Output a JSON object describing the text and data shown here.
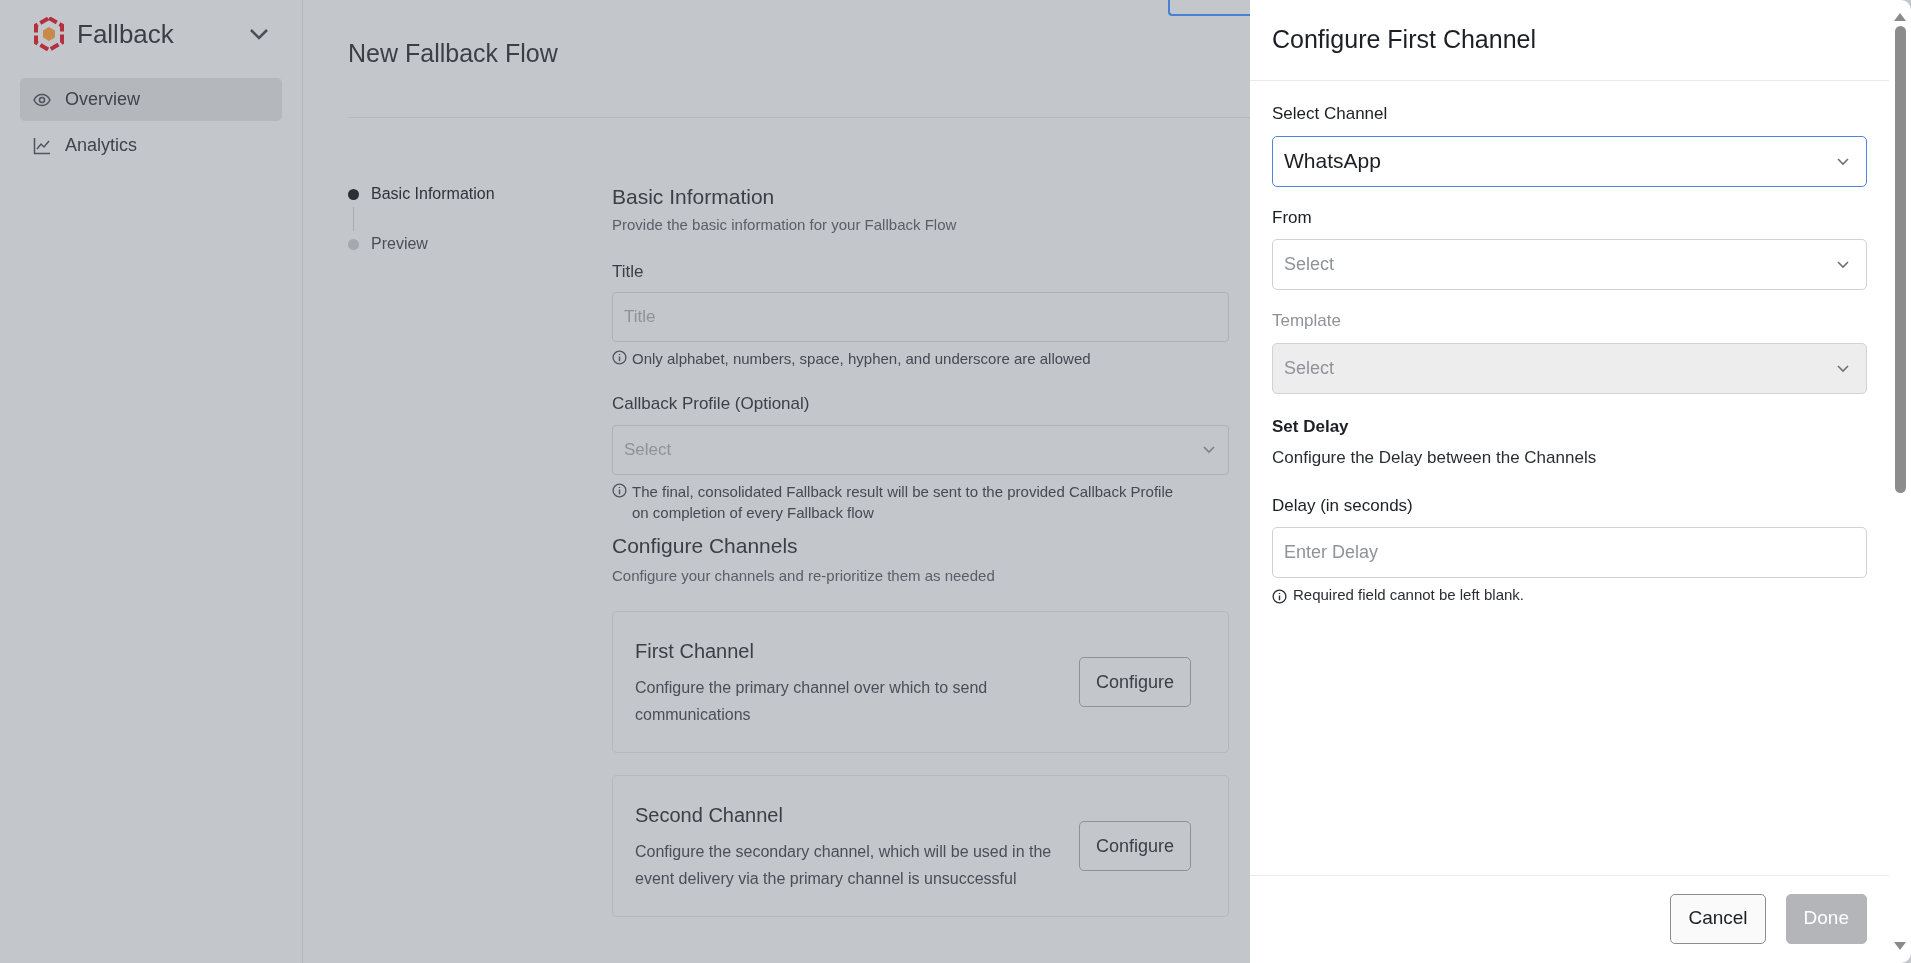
{
  "sidebar": {
    "brand": "Fallback",
    "items": [
      {
        "label": "Overview",
        "kind": "eye",
        "selected": true
      },
      {
        "label": "Analytics",
        "kind": "chart",
        "selected": false
      }
    ]
  },
  "page": {
    "title": "New Fallback Flow"
  },
  "steps": [
    {
      "label": "Basic Information",
      "selected": true
    },
    {
      "label": "Preview",
      "selected": false
    }
  ],
  "basic_info": {
    "heading": "Basic Information",
    "subtitle": "Provide the basic information for your Fallback Flow",
    "fields": [
      {
        "label": "Title",
        "kind": "input",
        "placeholder": "Title",
        "hint": "Only alphabet, numbers, space, hyphen, and underscore are allowed"
      },
      {
        "label": "Callback Profile (Optional)",
        "kind": "select",
        "placeholder": "Select",
        "hint": "The final, consolidated Fallback result will be sent to the provided Callback Profile on completion of every Fallback flow"
      }
    ]
  },
  "channels": {
    "heading": "Configure Channels",
    "subtitle": "Configure your channels and re-prioritize them as needed",
    "cards": [
      {
        "title": "First Channel",
        "description": "Configure the primary channel over which to send communications",
        "button": "Configure"
      },
      {
        "title": "Second Channel",
        "description": "Configure the secondary channel, which will be used in the event delivery via the primary channel is unsuccessful",
        "button": "Configure"
      }
    ]
  },
  "drawer": {
    "title": "Configure First Channel",
    "fields": [
      {
        "label": "Select Channel",
        "value": "WhatsApp",
        "focused": true,
        "disabled": false
      },
      {
        "label": "From",
        "placeholder": "Select",
        "focused": false,
        "disabled": false
      },
      {
        "label": "Template",
        "placeholder": "Select",
        "focused": false,
        "disabled": true
      }
    ],
    "delay": {
      "heading": "Set Delay",
      "description": "Configure the Delay between the Channels",
      "label": "Delay (in seconds)",
      "placeholder": "Enter Delay",
      "error": "Required field cannot be left blank."
    },
    "buttons": [
      {
        "label": "Cancel",
        "disabled": false
      },
      {
        "label": "Done",
        "disabled": true
      }
    ]
  }
}
